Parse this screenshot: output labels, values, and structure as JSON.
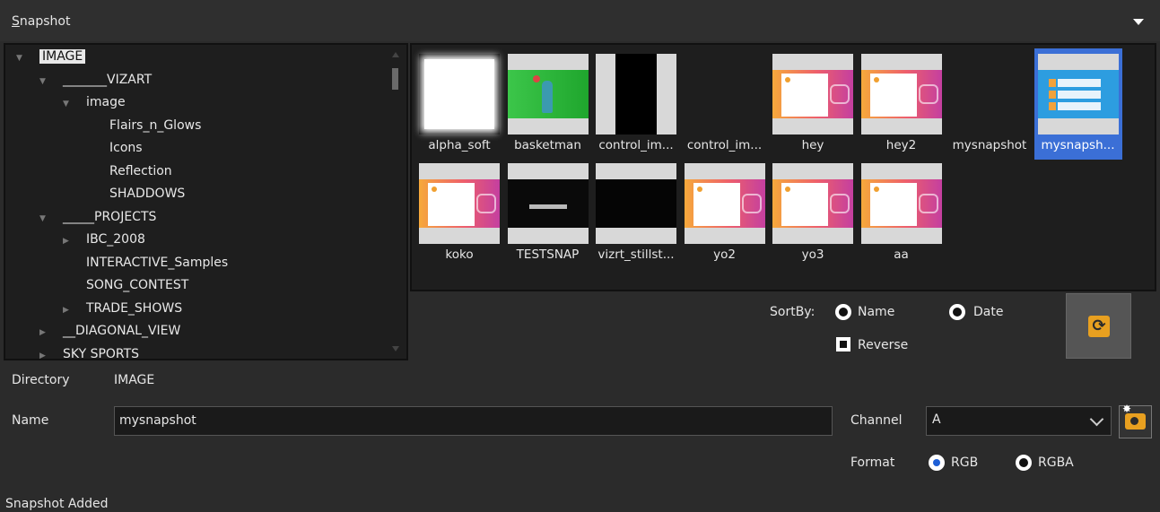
{
  "panel": {
    "title_prefix": "S",
    "title_rest": "napshot"
  },
  "tree": {
    "items": [
      {
        "label": "IMAGE",
        "selected": true,
        "expanded": true
      },
      {
        "label": "_______VIZART",
        "expanded": true
      },
      {
        "label": "image",
        "expanded": true
      },
      {
        "label": "Flairs_n_Glows"
      },
      {
        "label": "Icons"
      },
      {
        "label": "Reflection"
      },
      {
        "label": "SHADDOWS"
      },
      {
        "label": "_____PROJECTS",
        "expanded": true
      },
      {
        "label": "IBC_2008",
        "expanded": false
      },
      {
        "label": "INTERACTIVE_Samples"
      },
      {
        "label": "SONG_CONTEST"
      },
      {
        "label": "TRADE_SHOWS",
        "expanded": false
      },
      {
        "label": "__DIAGONAL_VIEW",
        "expanded": false
      },
      {
        "label": "SKY SPORTS",
        "expanded": false
      }
    ]
  },
  "thumbnails": [
    {
      "caption": "alpha_soft",
      "kind": "alpha"
    },
    {
      "caption": "basketman",
      "kind": "green"
    },
    {
      "caption": "control_im...",
      "kind": "black"
    },
    {
      "caption": "control_im...",
      "kind": "none"
    },
    {
      "caption": "hey",
      "kind": "insta"
    },
    {
      "caption": "hey2",
      "kind": "insta"
    },
    {
      "caption": "mysnapshot",
      "kind": "none"
    },
    {
      "caption": "mysnapsh...",
      "kind": "blue",
      "selected": true
    },
    {
      "caption": "koko",
      "kind": "insta"
    },
    {
      "caption": "TESTSNAP",
      "kind": "test"
    },
    {
      "caption": "vizrt_stillst...",
      "kind": "vblack"
    },
    {
      "caption": "yo2",
      "kind": "insta"
    },
    {
      "caption": "yo3",
      "kind": "insta"
    },
    {
      "caption": "aa",
      "kind": "insta"
    }
  ],
  "sort": {
    "label": "SortBy:",
    "name_label": "Name",
    "date_label": "Date",
    "reverse_label": "Reverse",
    "selected": "none",
    "reverse_checked": false
  },
  "directory": {
    "label": "Directory",
    "value": "IMAGE"
  },
  "name_field": {
    "label": "Name",
    "value": "mysnapshot"
  },
  "channel": {
    "label": "Channel",
    "value": "A"
  },
  "format": {
    "label": "Format",
    "rgb_label": "RGB",
    "rgba_label": "RGBA",
    "selected": "RGB"
  },
  "status": "Snapshot Added",
  "icons": {
    "refresh": "refresh-icon",
    "snapshot": "camera-flash-icon",
    "collapse": "triangle-down-icon"
  },
  "colors": {
    "background": "#2b2b2b",
    "selection": "#3b6fd6",
    "accent": "#e8a020"
  }
}
